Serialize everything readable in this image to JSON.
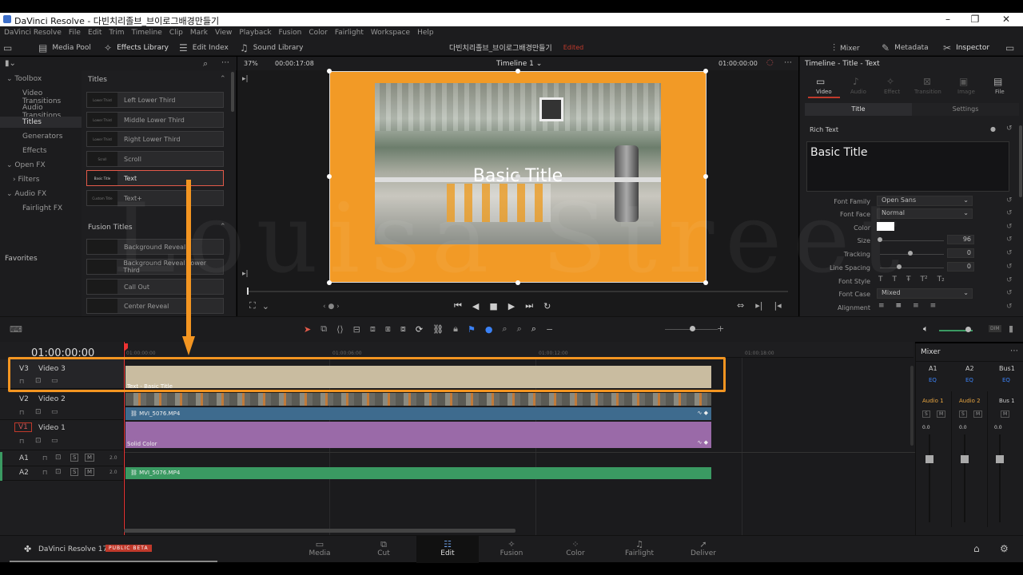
{
  "window": {
    "title": "DaVinci Resolve - 다빈치리졸브_브이로그배경만들기"
  },
  "menu": [
    "DaVinci Resolve",
    "File",
    "Edit",
    "Trim",
    "Timeline",
    "Clip",
    "Mark",
    "View",
    "Playback",
    "Fusion",
    "Color",
    "Fairlight",
    "Workspace",
    "Help"
  ],
  "toolbar": {
    "media_pool": "Media Pool",
    "effects_library": "Effects Library",
    "edit_index": "Edit Index",
    "sound_library": "Sound Library",
    "project_name": "다빈치리졸브_브이로그배경만들기",
    "edited": "Edited",
    "mixer": "Mixer",
    "metadata": "Metadata",
    "inspector": "Inspector"
  },
  "effects": {
    "tree": [
      "Toolbox",
      "Video Transitions",
      "Audio Transitions",
      "Titles",
      "Generators",
      "Effects",
      "Open FX",
      "Filters",
      "Audio FX",
      "Fairlight FX"
    ],
    "favorites": "Favorites",
    "titles_header": "Titles",
    "titles": [
      {
        "thumb": "Lower Third",
        "label": "Left Lower Third"
      },
      {
        "thumb": "Lower Third",
        "label": "Middle Lower Third"
      },
      {
        "thumb": "Lower Third",
        "label": "Right Lower Third"
      },
      {
        "thumb": "Scroll",
        "label": "Scroll"
      },
      {
        "thumb": "Basic Title",
        "label": "Text"
      },
      {
        "thumb": "Custom Title",
        "label": "Text+"
      }
    ],
    "fusion_header": "Fusion Titles",
    "fusion_titles": [
      "Background Reveal",
      "Background Reveal Lower Third",
      "Call Out",
      "Center Reveal"
    ]
  },
  "viewer": {
    "zoom": "37%",
    "timecode_left": "00:00:17:08",
    "timeline_name": "Timeline 1",
    "timecode_right": "01:00:00:00",
    "title_text": "Basic Title"
  },
  "inspector": {
    "header": "Timeline - Title - Text",
    "tabs": [
      "Video",
      "Audio",
      "Effect",
      "Transition",
      "Image",
      "File"
    ],
    "subtabs": [
      "Title",
      "Settings"
    ],
    "rich_text": "Rich Text",
    "text_value": "Basic Title",
    "fields": {
      "font_family_label": "Font Family",
      "font_family": "Open Sans",
      "font_face_label": "Font Face",
      "font_face": "Normal",
      "color_label": "Color",
      "size_label": "Size",
      "size": "96",
      "tracking_label": "Tracking",
      "tracking": "0",
      "line_spacing_label": "Line Spacing",
      "line_spacing": "0",
      "font_style_label": "Font Style",
      "font_case_label": "Font Case",
      "font_case": "Mixed",
      "alignment_label": "Alignment"
    }
  },
  "timeline": {
    "timecode": "01:00:00:00",
    "ruler": [
      "01:00:00:00",
      "01:00:06:00",
      "01:00:12:00",
      "01:00:18:00"
    ],
    "tracks": [
      {
        "id": "V3",
        "name": "Video 3"
      },
      {
        "id": "V2",
        "name": "Video 2"
      },
      {
        "id": "V1",
        "name": "Video 1"
      },
      {
        "id": "A1",
        "level": "2.0"
      },
      {
        "id": "A2",
        "level": "2.0"
      }
    ],
    "clips": {
      "v3": "Text - Basic Title",
      "v2": "MVI_5076.MP4",
      "v1": "Solid Color",
      "a2": "MVI_5076.MP4"
    },
    "track_buttons": {
      "solo": "S",
      "mute": "M"
    }
  },
  "mixer": {
    "title": "Mixer",
    "channels": [
      "A1",
      "A2",
      "Bus1"
    ],
    "eq": "EQ",
    "names": [
      "Audio 1",
      "Audio 2",
      "Bus 1"
    ],
    "values": [
      "0.0",
      "0.0",
      "0.0"
    ],
    "dim": "DIM"
  },
  "pages": [
    "Media",
    "Cut",
    "Edit",
    "Fusion",
    "Color",
    "Fairlight",
    "Deliver"
  ],
  "brand": {
    "name": "DaVinci Resolve 17",
    "badge": "PUBLIC BETA"
  },
  "watermark": "Louisa Street",
  "colors": {
    "accent_orange": "#f39521",
    "v3_clip": "#c9bca0",
    "v2_clip": "#3e6b8e",
    "v1_clip": "#9a6aa8",
    "audio_clip": "#3a9a62",
    "playhead": "#e33"
  }
}
